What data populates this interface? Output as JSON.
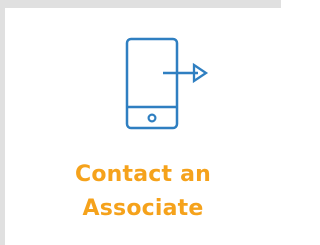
{
  "tile": {
    "label_line1": "Contact an",
    "label_line2": "Associate",
    "icon": "mobile-phone-arrow-icon"
  },
  "colors": {
    "icon": "#2f7fc1",
    "label": "#f5a21b",
    "frame": "#e0e0e0"
  }
}
